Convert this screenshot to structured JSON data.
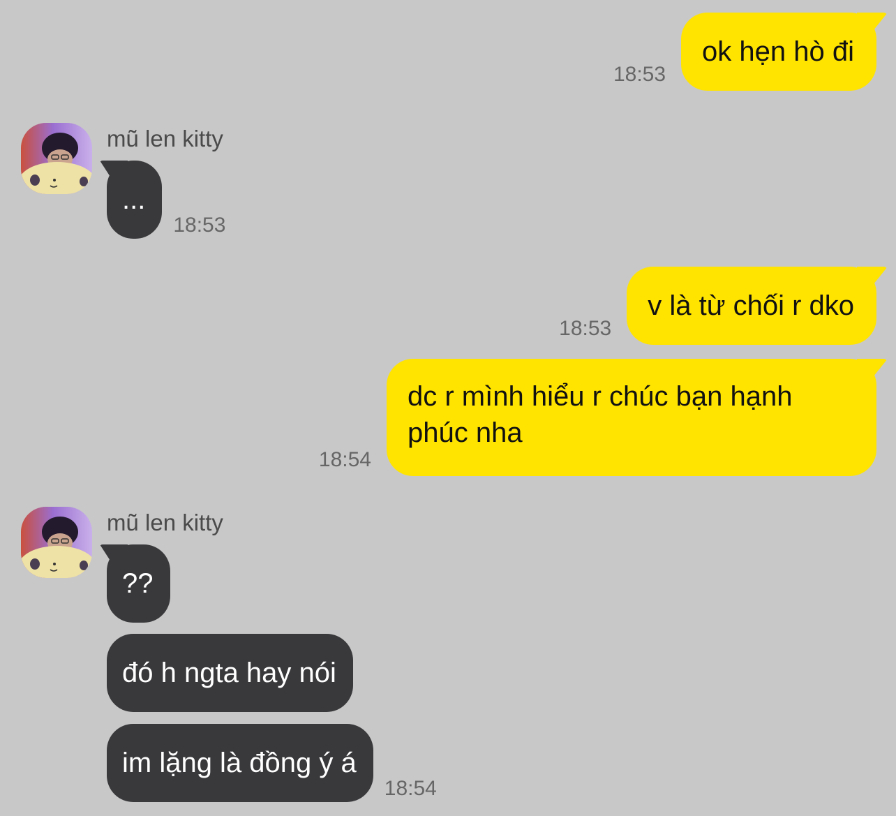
{
  "messages": {
    "m1": {
      "text": "ok hẹn hò đi",
      "time": "18:53"
    },
    "m2": {
      "sender": "mũ len kitty",
      "text": "...",
      "time": "18:53"
    },
    "m3": {
      "text": "v là từ chối r dko",
      "time": "18:53"
    },
    "m4": {
      "text": "dc r mình hiểu r chúc bạn hạnh phúc nha",
      "time": "18:54"
    },
    "m5": {
      "sender": "mũ len kitty",
      "text": "??"
    },
    "m6": {
      "text": "đó h ngta hay nói"
    },
    "m7": {
      "text": "im lặng là đồng ý á",
      "time": "18:54"
    }
  },
  "colors": {
    "background": "#c8c8c8",
    "outgoing_bubble": "#ffe400",
    "incoming_bubble": "#39393c",
    "timestamp": "#666666"
  }
}
